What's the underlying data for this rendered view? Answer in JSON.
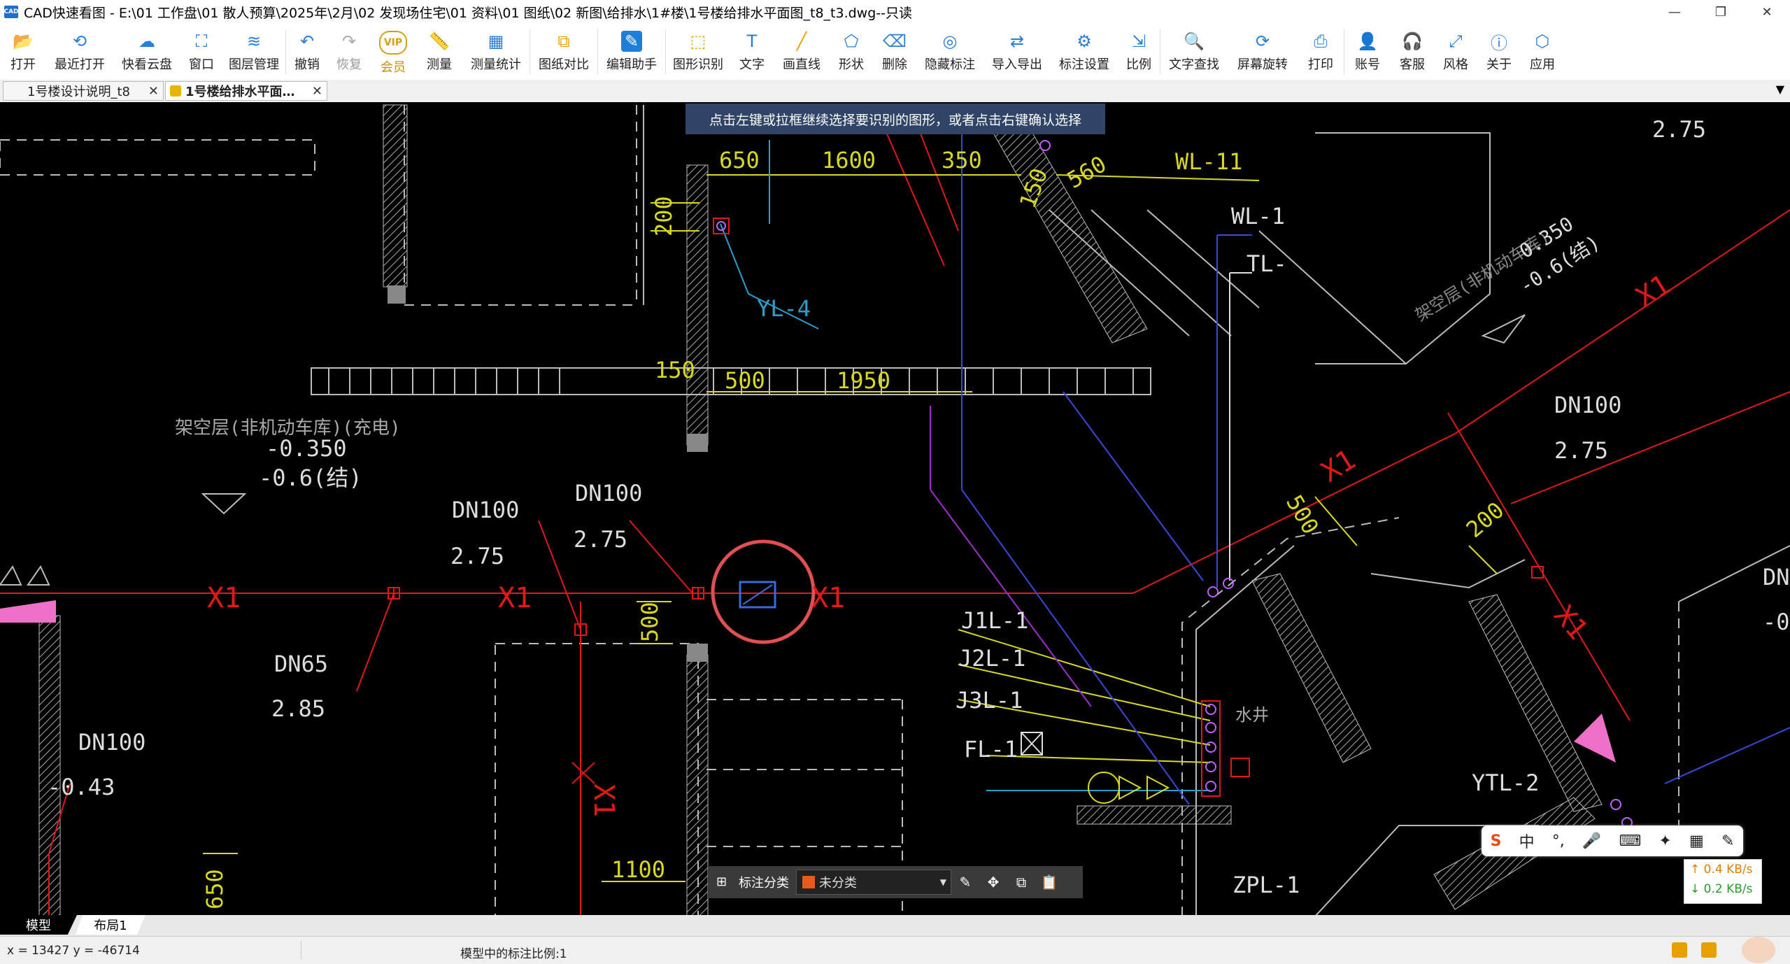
{
  "window": {
    "app_icon": "cad-app-icon",
    "title": "CAD快速看图 - E:\\01 工作盘\\01 散人预算\\2025年\\2月\\02 发现场住宅\\01 资料\\01 图纸\\02 新图\\给排水\\1#楼\\1号楼给排水平面图_t8_t3.dwg--只读",
    "minimize": "—",
    "restore": "❐",
    "close": "✕"
  },
  "toolbar": {
    "items": [
      {
        "label": "打开",
        "icon": "folder-open-icon"
      },
      {
        "label": "最近打开",
        "icon": "history-icon"
      },
      {
        "label": "快看云盘",
        "icon": "cloud-icon"
      },
      {
        "label": "窗口",
        "icon": "window-icon"
      },
      {
        "label": "图层管理",
        "icon": "layers-icon"
      },
      {
        "label": "撤销",
        "icon": "undo-icon"
      },
      {
        "label": "恢复",
        "icon": "redo-icon"
      },
      {
        "label": "会员",
        "icon": "vip-icon"
      },
      {
        "label": "测量",
        "icon": "ruler-icon"
      },
      {
        "label": "测量统计",
        "icon": "measure-stats-icon"
      },
      {
        "label": "图纸对比",
        "icon": "compare-icon"
      },
      {
        "label": "编辑助手",
        "icon": "edit-assistant-icon"
      },
      {
        "label": "图形识别",
        "icon": "shape-recognition-icon"
      },
      {
        "label": "文字",
        "icon": "text-icon"
      },
      {
        "label": "画直线",
        "icon": "line-icon"
      },
      {
        "label": "形状",
        "icon": "shape-icon"
      },
      {
        "label": "删除",
        "icon": "eraser-icon"
      },
      {
        "label": "隐藏标注",
        "icon": "hide-annotation-icon"
      },
      {
        "label": "导入导出",
        "icon": "import-export-icon"
      },
      {
        "label": "标注设置",
        "icon": "annotation-settings-icon"
      },
      {
        "label": "比例",
        "icon": "scale-icon"
      },
      {
        "label": "文字查找",
        "icon": "text-search-icon"
      },
      {
        "label": "屏幕旋转",
        "icon": "rotate-screen-icon"
      },
      {
        "label": "打印",
        "icon": "printer-icon"
      },
      {
        "label": "账号",
        "icon": "user-icon"
      },
      {
        "label": "客服",
        "icon": "headset-icon"
      },
      {
        "label": "风格",
        "icon": "style-icon"
      },
      {
        "label": "关于",
        "icon": "info-icon"
      },
      {
        "label": "应用",
        "icon": "apps-icon"
      }
    ]
  },
  "tabs": [
    {
      "label": "1号楼设计说明_t8",
      "close": "✕"
    },
    {
      "label": "1号楼给排水平面…",
      "close": "✕"
    }
  ],
  "tab_dropdown": "▼",
  "canvas": {
    "hint": "点击左键或拉框继续选择要识别的图形，或者点击右键确认选择",
    "labels": {
      "d650": "650",
      "d1600": "1600",
      "d350": "350",
      "d200a": "200",
      "d150a": "150",
      "d560": "560",
      "d500a": "500",
      "d1950": "1950",
      "d500b": "500",
      "d500c": "500",
      "d200b": "200",
      "d1100": "1100",
      "d650b": "650",
      "wl11": "WL-11",
      "wl1": "WL-1",
      "tl": "TL-",
      "yl4": "YL-4",
      "lvl275a": "2.75",
      "lvl275b": "2.75",
      "lvl275c": "2.75",
      "lvl275d": "2.75",
      "lvl285": "2.85",
      "lvl043": "-0.43",
      "lvl0350": "-0.350",
      "lvl06": "-0.6(结)",
      "lvl0350b": "0.350",
      "lvl06b": "-0.6(结)",
      "dn100a": "DN100",
      "dn100b": "DN100",
      "dn100c": "DN100",
      "dn100d": "DN100",
      "dn65": "DN65",
      "dn_edge": "DN",
      "lvl0_edge": "-0",
      "x1a": "X1",
      "x1b": "X1",
      "x1c": "X1",
      "x1d": "X1",
      "x1e": "X1",
      "x1f": "X1",
      "x1g": "X1",
      "room1": "架空层(非机动车库)(充电)",
      "room2": "架空层(非机动车库)",
      "j1l1": "J1L-1",
      "j2l1": "J2L-1",
      "j3l1": "J3L-1",
      "fl1": "FL-1",
      "shuijing": "水井",
      "ytl2": "YTL-2",
      "zpl1": "ZPL-1"
    }
  },
  "annot_bar": {
    "label": "标注分类",
    "selected": "未分类",
    "selected_color": "#e85a1a"
  },
  "ime": {
    "chinese": "中",
    "punct": "°,",
    "mic": "🎤",
    "keyboard": "⌨",
    "skin": "✦",
    "grid": "▦",
    "extra": "✎"
  },
  "netspeed": {
    "up": "↑ 0.4 KB/s",
    "down": "↓ 0.2 KB/s"
  },
  "layout_tabs": [
    "模型",
    "布局1"
  ],
  "status": {
    "coords": "x = 13427  y = -46714",
    "scale": "模型中的标注比例:1"
  }
}
